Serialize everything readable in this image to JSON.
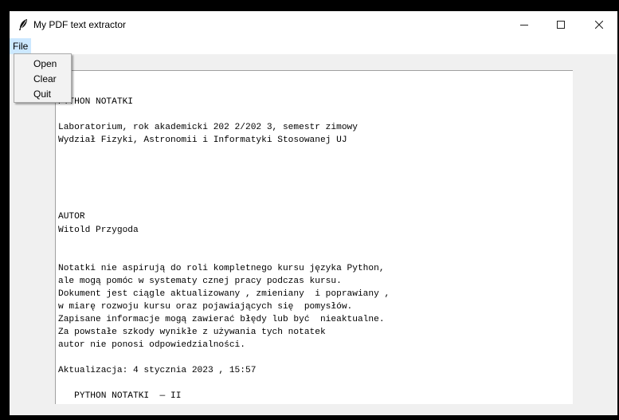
{
  "window": {
    "title": "My PDF text extractor",
    "icons": {
      "app": "feather-icon",
      "minimize": "minimize-icon",
      "maximize": "maximize-icon",
      "close": "close-icon"
    }
  },
  "menubar": {
    "file_label": "File"
  },
  "file_menu": {
    "items": [
      "Open",
      "Clear",
      "Quit"
    ]
  },
  "text_content": {
    "lines": [
      "PYTHON NOTATKI",
      "Laboratorium, rok akademicki 202 2/202 3, semestr zimowy",
      "Wydział Fizyki, Astronomii i Informatyki Stosowanej UJ",
      "AUTOR",
      "Witold Przygoda",
      "Notatki nie aspirują do roli kompletnego kursu języka Python,",
      "ale mogą pomóc w systematy cznej pracy podczas kursu.",
      "Dokument jest ciągle aktualizowany , zmieniany  i poprawiany ,",
      "w miarę rozwoju kursu oraz pojawiających się  pomysłów.",
      "Zapisane informacje mogą zawierać błędy lub być  nieaktualne.",
      "Za powstałe szkody wynikłe z używania tych notatek",
      "autor nie ponosi odpowiedzialności.",
      "Aktualizacja: 4 stycznia 2023 , 15:57",
      "   PYTHON NOTATKI  — II"
    ]
  }
}
